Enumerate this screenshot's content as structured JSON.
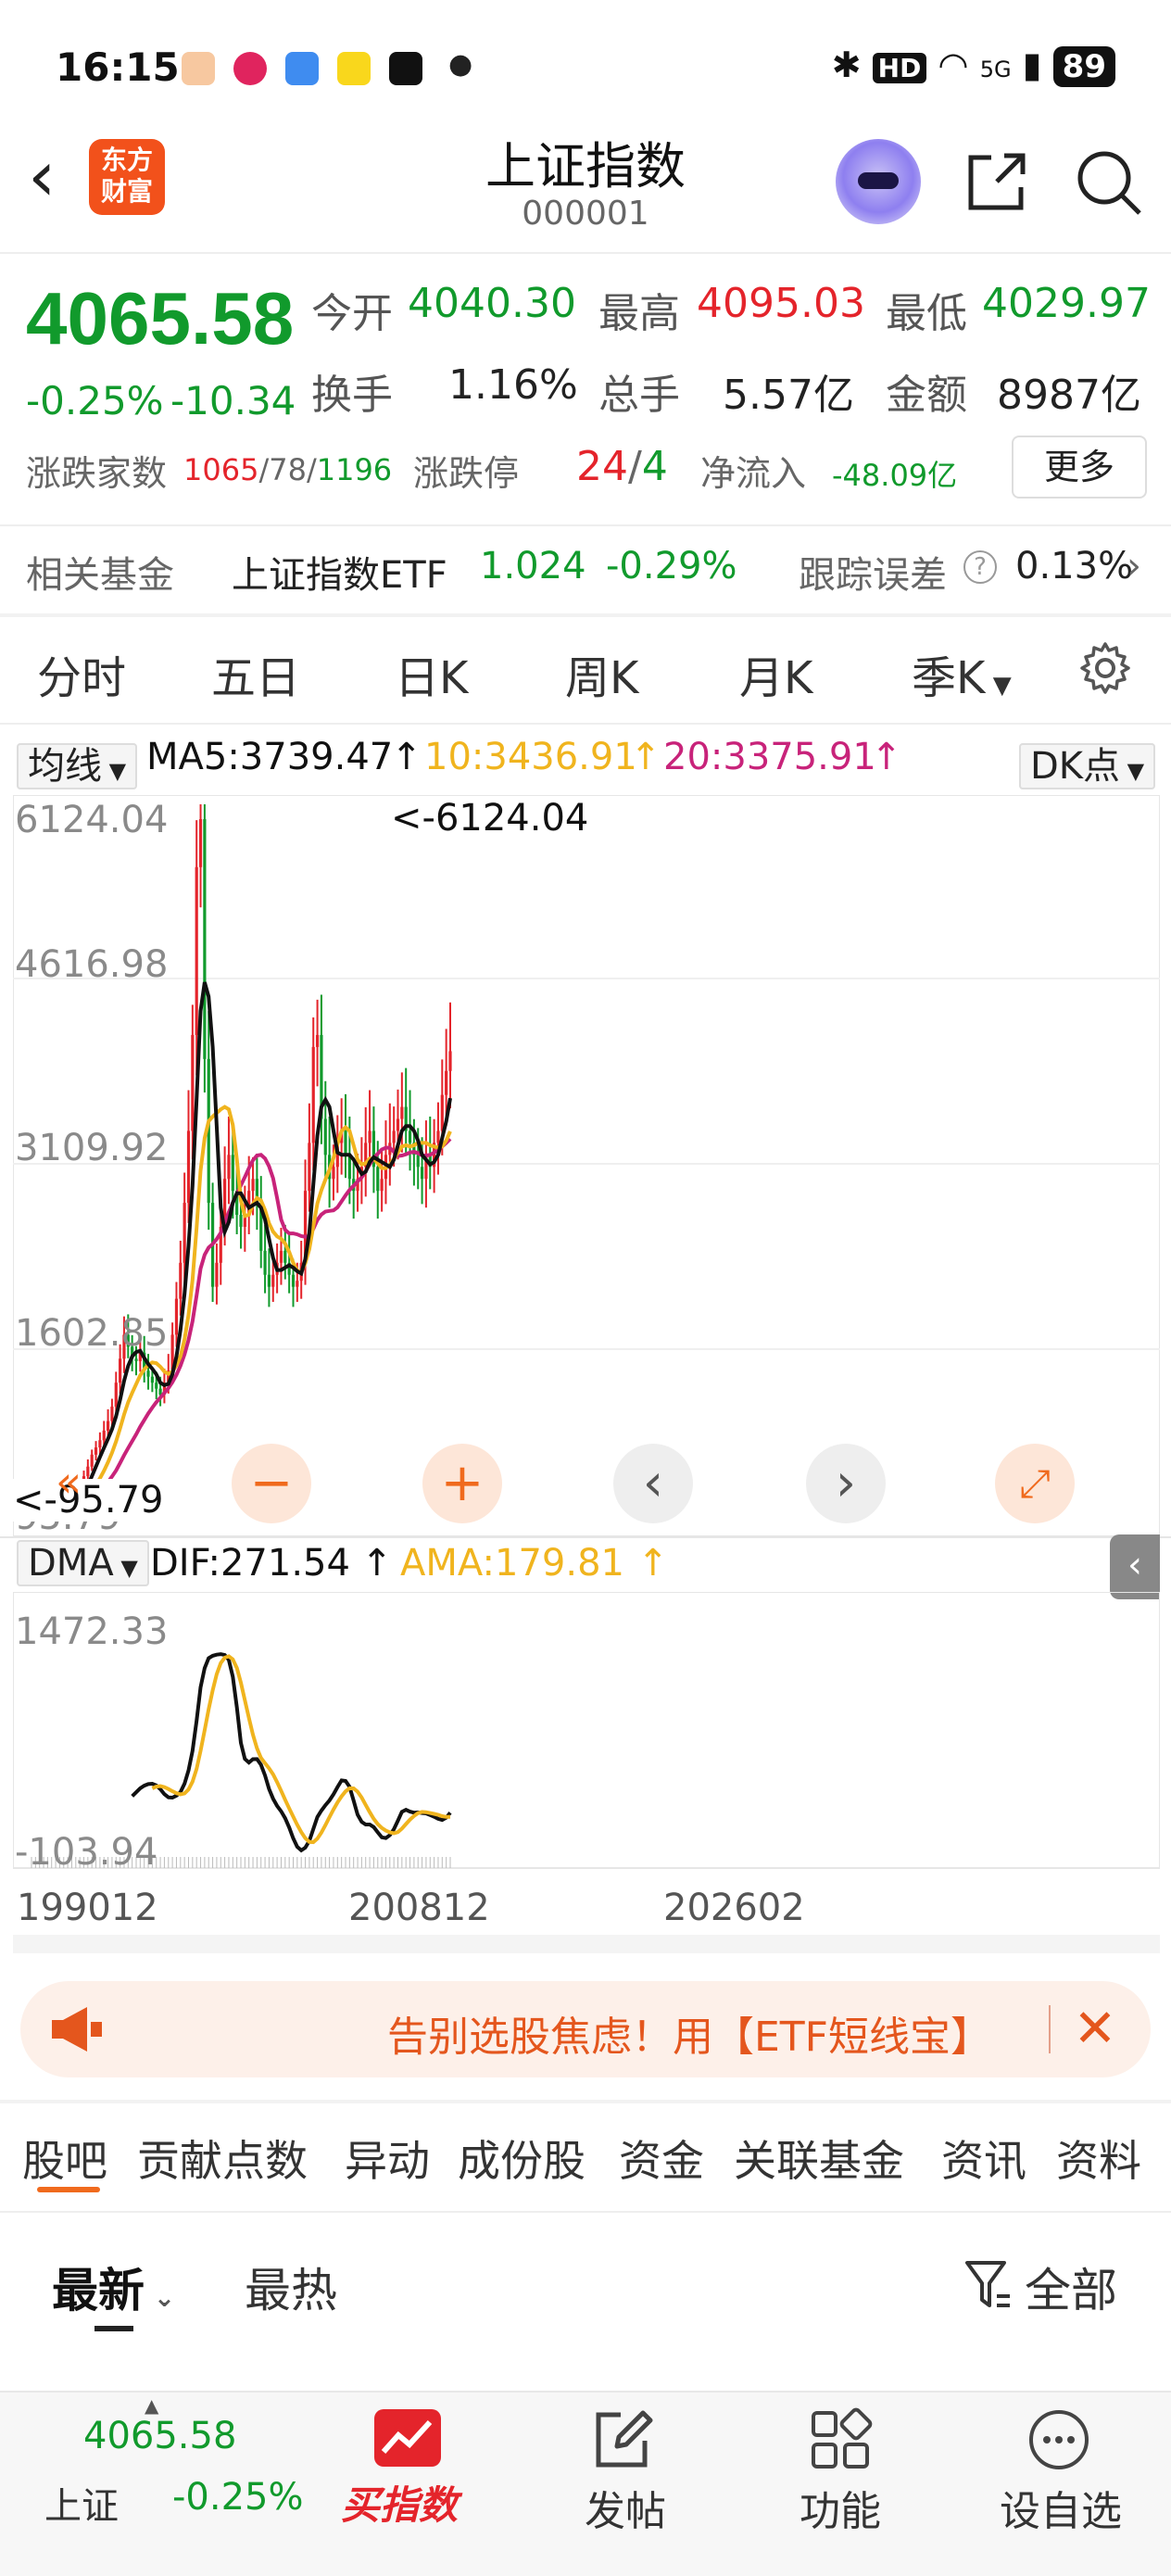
{
  "status_bar": {
    "time": "16:15",
    "battery": "89",
    "signal": "5G",
    "hd": "HD"
  },
  "header": {
    "logo_line1": "东方",
    "logo_line2": "财富",
    "title": "上证指数",
    "code": "000001"
  },
  "quote": {
    "price": "4065.58",
    "change_pct": "-0.25%",
    "change_abs": "-10.34",
    "open_label": "今开",
    "open": "4040.30",
    "high_label": "最高",
    "high": "4095.03",
    "low_label": "最低",
    "low": "4029.97",
    "turnover_label": "换手",
    "turnover": "1.16%",
    "volume_label": "总手",
    "volume": "5.57亿",
    "amount_label": "金额",
    "amount": "8987亿",
    "breadth_label": "涨跌家数",
    "breadth_up": "1065",
    "breadth_flat": "78",
    "breadth_down": "1196",
    "limit_label": "涨跌停",
    "limit_up": "24",
    "limit_down": "4",
    "inflow_label": "净流入",
    "inflow": "-48.09亿",
    "more_label": "更多"
  },
  "fund": {
    "label": "相关基金",
    "name": "上证指数ETF",
    "price": "1.024",
    "pct": "-0.29%",
    "err_label": "跟踪误差",
    "err_value": "0.13%"
  },
  "period_tabs": [
    "分时",
    "五日",
    "日K",
    "周K",
    "月K",
    "季K"
  ],
  "active_period": "季K",
  "ma_legend": {
    "select": "均线",
    "ma5": "MA5:3739.47",
    "ma10": "10:3436.91",
    "ma20": "20:3375.91",
    "dk": "DK点"
  },
  "kchart_axis": {
    "y1": "6124.04",
    "y2": "4616.98",
    "y3": "3109.92",
    "y4": "1602.85",
    "y5": "95.79",
    "max_marker": "<-6124.04",
    "min_marker": "<-95.79"
  },
  "dma_legend": {
    "select": "DMA",
    "dif": "DIF:271.54",
    "ama": "AMA:179.81"
  },
  "dma_axis": {
    "top": "1472.33",
    "bottom": "-103.94"
  },
  "x_axis": [
    "199012",
    "200812",
    "202602"
  ],
  "colors": {
    "up": "#e4242b",
    "down": "#119a2c",
    "ma5": "#111111",
    "ma10": "#f0b41e",
    "ma20": "#c8237a",
    "accent": "#f06a1d"
  },
  "banner": {
    "text": "告别选股焦虑！用【ETF短线宝】"
  },
  "info_tabs": [
    "股吧",
    "贡献点数",
    "异动",
    "成份股",
    "资金",
    "关联基金",
    "资讯",
    "资料"
  ],
  "sort_tabs": {
    "latest": "最新",
    "hot": "最热",
    "filter": "全部"
  },
  "bottom_nav": {
    "index_price": "4065.58",
    "index_name": "上证",
    "index_pct": "-0.25%",
    "buy_label": "买指数",
    "post_label": "发帖",
    "func_label": "功能",
    "watch_label": "设自选"
  }
}
